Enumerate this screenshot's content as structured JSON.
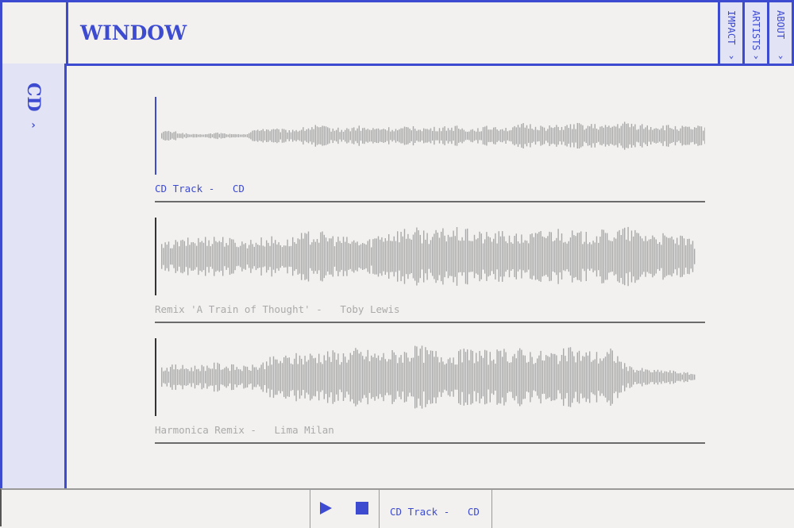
{
  "header": {
    "title": "WINDOW",
    "nav": [
      {
        "label": "IMPACT",
        "icon": "chevron-down-icon"
      },
      {
        "label": "ARTISTS",
        "icon": "chevron-down-icon"
      },
      {
        "label": "ABOUT",
        "icon": "chevron-down-icon"
      }
    ]
  },
  "sidebar": {
    "label": "CD",
    "icon": "chevron-right-icon"
  },
  "colors": {
    "accent": "#3d4bd1",
    "panel": "#e2e3f5",
    "wave": "#a9a9a9",
    "muted_text": "#aaaaaa",
    "background": "#f2f1ef"
  },
  "tracks": [
    {
      "title": "CD Track",
      "separator": " -   ",
      "artist": "CD",
      "active": true,
      "playhead_progress": 0.0,
      "envelope": [
        0.15,
        0.12,
        0.05,
        0.04,
        0.1,
        0.05,
        0.04,
        0.25,
        0.2,
        0.18,
        0.22,
        0.3,
        0.25,
        0.2,
        0.28,
        0.22,
        0.25,
        0.2,
        0.3,
        0.22,
        0.25,
        0.28,
        0.2,
        0.25,
        0.3,
        0.22,
        0.35,
        0.3,
        0.28,
        0.3,
        0.35,
        0.32,
        0.28,
        0.4,
        0.35,
        0.3,
        0.3,
        0.28,
        0.25,
        0.3
      ]
    },
    {
      "title": "Remix 'A Train of Thought'",
      "separator": " -   ",
      "artist": "Toby Lewis",
      "active": false,
      "playhead_progress": 0.0,
      "envelope": [
        0.35,
        0.45,
        0.5,
        0.55,
        0.6,
        0.5,
        0.45,
        0.5,
        0.55,
        0.45,
        0.6,
        0.7,
        0.65,
        0.55,
        0.5,
        0.45,
        0.7,
        0.75,
        0.8,
        0.75,
        0.7,
        0.8,
        0.75,
        0.7,
        0.65,
        0.7,
        0.6,
        0.65,
        0.75,
        0.8,
        0.7,
        0.65,
        0.7,
        0.75,
        0.8,
        0.7,
        0.65,
        0.6,
        0.55,
        0.4
      ]
    },
    {
      "title": "Harmonica Remix",
      "separator": " -   ",
      "artist": "Lima Milan",
      "active": false,
      "playhead_progress": 0.0,
      "envelope": [
        0.3,
        0.35,
        0.3,
        0.35,
        0.4,
        0.35,
        0.3,
        0.35,
        0.55,
        0.6,
        0.65,
        0.7,
        0.75,
        0.7,
        0.8,
        0.75,
        0.7,
        0.75,
        0.8,
        0.85,
        0.75,
        0.7,
        0.75,
        0.8,
        0.7,
        0.75,
        0.8,
        0.75,
        0.7,
        0.75,
        0.8,
        0.75,
        0.7,
        0.8,
        0.3,
        0.25,
        0.2,
        0.2,
        0.15,
        0.1
      ]
    }
  ],
  "player": {
    "play_icon": "play-icon",
    "stop_icon": "stop-icon",
    "now_playing": "CD Track -   CD"
  }
}
